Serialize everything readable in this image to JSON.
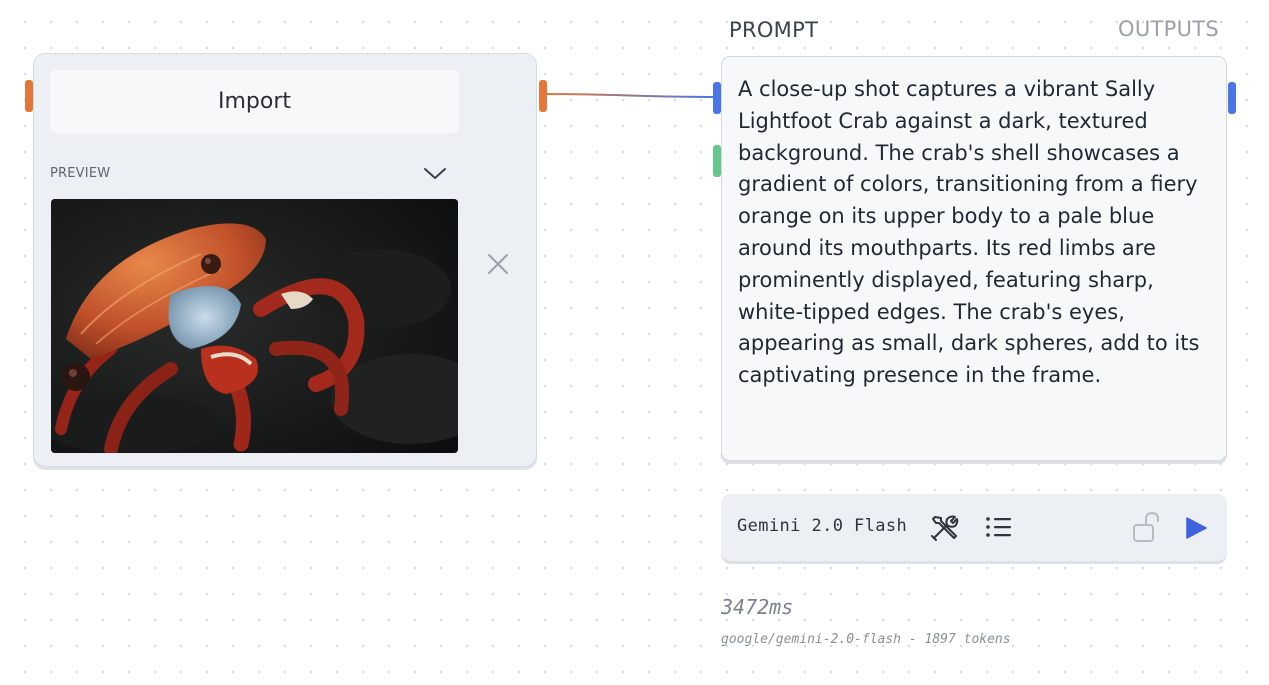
{
  "import_node": {
    "button_label": "Import",
    "preview_label": "PREVIEW",
    "image_subject": "Sally Lightfoot crab on dark rock"
  },
  "prompt_node": {
    "title": "PROMPT",
    "outputs_label": "OUTPUTS",
    "text": "A close-up shot captures a vibrant Sally Lightfoot Crab against a dark, textured background. The crab's shell showcases a gradient of colors, transitioning from a fiery orange on its upper body to a pale blue around its mouthparts. Its red limbs are prominently displayed, featuring sharp, white-tipped edges. The crab's eyes, appearing as small, dark spheres, add to its captivating presence in the frame."
  },
  "toolbar": {
    "model_name": "Gemini 2.0 Flash",
    "icons": [
      "tools-icon",
      "list-icon",
      "unlock-icon",
      "play-icon"
    ]
  },
  "result": {
    "timing": "3472ms",
    "meta": "google/gemini-2.0-flash - 1897 tokens"
  },
  "colors": {
    "handle_orange": "#e2773a",
    "handle_blue": "#4b76e8",
    "handle_green": "#66c78a",
    "play_accent": "#3d63dd"
  }
}
